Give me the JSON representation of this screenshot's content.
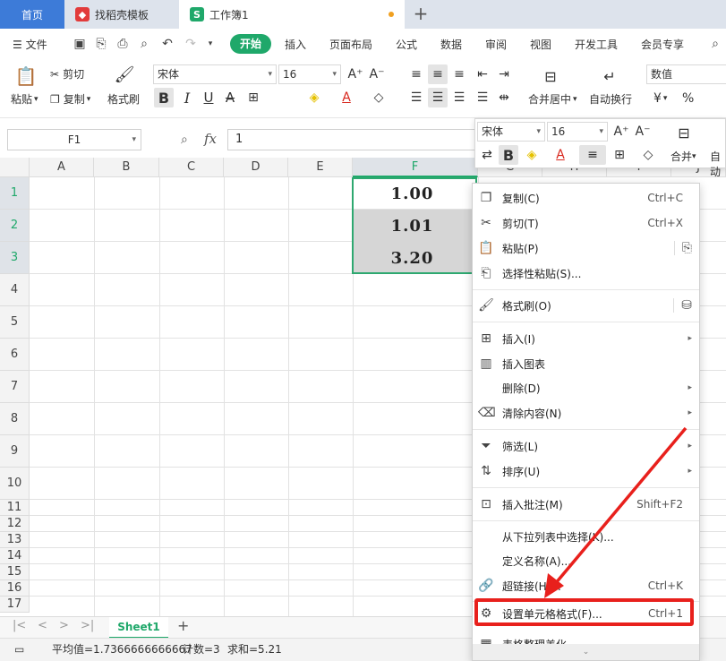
{
  "tabs": {
    "home": "首页",
    "docer": "找稻壳模板",
    "workbook": "工作簿1"
  },
  "menu": {
    "file": "文件",
    "items": [
      "开始",
      "插入",
      "页面布局",
      "公式",
      "数据",
      "审阅",
      "视图",
      "开发工具",
      "会员专享"
    ]
  },
  "ribbon": {
    "paste": "粘贴",
    "cut": "剪切",
    "copy": "复制",
    "format_painter": "格式刷",
    "font": "宋体",
    "size": "16",
    "merge": "合并居中",
    "wrap": "自动换行",
    "numfmt": "数值",
    "currency": "¥",
    "percent": "%"
  },
  "formula": {
    "name": "F1",
    "fx": "fx",
    "value": "1"
  },
  "columns": [
    "A",
    "B",
    "C",
    "D",
    "E",
    "F",
    "G",
    "H",
    "I",
    "J"
  ],
  "rows": [
    "1",
    "2",
    "3",
    "4",
    "5",
    "6",
    "7",
    "8",
    "9",
    "10",
    "11",
    "12",
    "13",
    "14",
    "15",
    "16",
    "17"
  ],
  "cells": {
    "F1": "1.00",
    "F2": "1.01",
    "F3": "3.20"
  },
  "sheet": {
    "name": "Sheet1"
  },
  "status": {
    "avg": "平均值=1.7366666666667",
    "count": "计数=3",
    "sum": "求和=5.21"
  },
  "mini": {
    "font": "宋体",
    "size": "16",
    "merge": "合并",
    "wrap": "自动"
  },
  "context_menu": {
    "copy": "复制(C)",
    "copy_sc": "Ctrl+C",
    "cut": "剪切(T)",
    "cut_sc": "Ctrl+X",
    "paste": "粘贴(P)",
    "paste_special": "选择性粘贴(S)...",
    "format_painter": "格式刷(O)",
    "insert": "插入(I)",
    "insert_chart": "插入图表",
    "delete": "删除(D)",
    "clear": "清除内容(N)",
    "filter": "筛选(L)",
    "sort": "排序(U)",
    "comment": "插入批注(M)",
    "comment_sc": "Shift+F2",
    "pick_list": "从下拉列表中选择(K)...",
    "define_name": "定义名称(A)...",
    "hyperlink": "超链接(H)...",
    "hyperlink_sc": "Ctrl+K",
    "format_cells": "设置单元格格式(F)...",
    "format_cells_sc": "Ctrl+1",
    "beautify": "表格整理美化"
  },
  "colors": {
    "accent": "#1fa86a",
    "highlight": "#e8201c",
    "home_tab": "#3d7bd8"
  }
}
